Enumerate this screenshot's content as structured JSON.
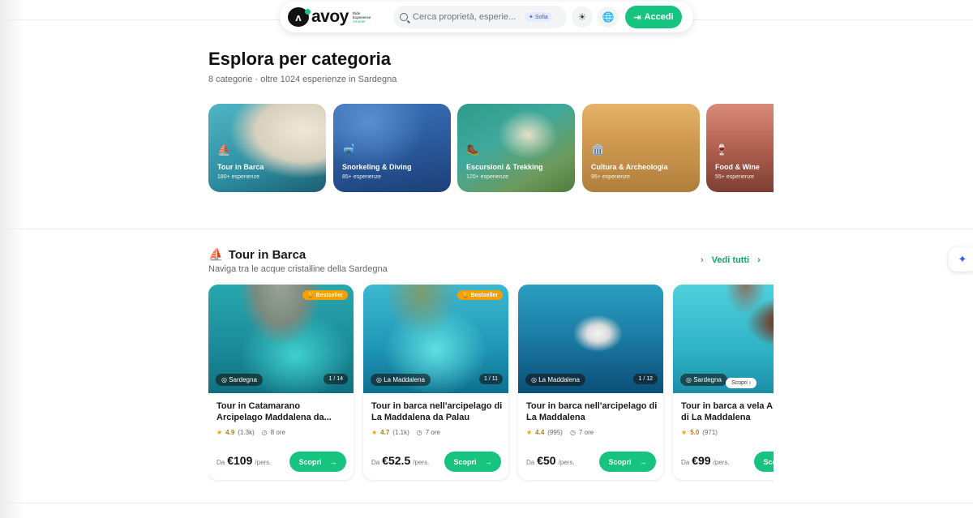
{
  "header": {
    "logo_word": "avoy",
    "logo_tag": [
      "Ride",
      "Experience",
      "Smarter"
    ],
    "search_placeholder": "Cerca proprietà, esperie...",
    "assistant_badge": "Sofia",
    "login_label": "Accedi",
    "icons": [
      "sun-icon",
      "globe-icon"
    ]
  },
  "categories_section": {
    "title": "Esplora per categoria",
    "subtitle": "8 categorie · oltre 1024 esperienze in Sardegna",
    "items": [
      {
        "icon": "⛵",
        "name": "Tour in Barca",
        "count": "180+ esperienze",
        "color_a": "#3fa7b8",
        "color_b": "#d9d4c6"
      },
      {
        "icon": "🤿",
        "name": "Snorkeling & Diving",
        "count": "85+ esperienze",
        "color_a": "#2b5fa8",
        "color_b": "#3a7cc4"
      },
      {
        "icon": "🥾",
        "name": "Escursioni & Trekking",
        "count": "120+ esperienze",
        "color_a": "#4aa89a",
        "color_b": "#6b8f55"
      },
      {
        "icon": "🏛️",
        "name": "Cultura & Archeologia",
        "count": "95+ esperienze",
        "color_a": "#c99a55",
        "color_b": "#b07f3c"
      },
      {
        "icon": "🍷",
        "name": "Food & Wine",
        "count": "55+ esperienze",
        "color_a": "#c96f6f",
        "color_b": "#8f4a3c"
      }
    ]
  },
  "tour_section": {
    "icon": "⛵",
    "title": "Tour in Barca",
    "subtitle": "Naviga tra le acque cristalline della Sardegna",
    "see_all": "Vedi tutti",
    "cards": [
      {
        "badge": "Bestseller",
        "location": "Sardegna",
        "pager": "1 / 14",
        "title": "Tour in Catamarano Arcipelago Maddalena da...",
        "rating": "4.9",
        "reviews": "(1.3k)",
        "duration": "8 ore",
        "price_prefix": "Da",
        "price": "€109",
        "price_unit": "/pers.",
        "cta": "Scopri",
        "color_a": "#1fa7b0",
        "color_b": "#0e6f86"
      },
      {
        "badge": "Bestseller",
        "location": "La Maddalena",
        "pager": "1 / 11",
        "title": "Tour in barca nell'arcipelago di La Maddalena da Palau",
        "rating": "4.7",
        "reviews": "(1.1k)",
        "duration": "7 ore",
        "price_prefix": "Da",
        "price": "€52.5",
        "price_unit": "/pers.",
        "cta": "Scopri",
        "color_a": "#24b3c4",
        "color_b": "#0f6f8f"
      },
      {
        "badge": "",
        "location": "La Maddalena",
        "pager": "1 / 12",
        "title": "Tour in barca nell'arcipelago di La Maddalena",
        "rating": "4.4",
        "reviews": "(995)",
        "duration": "7 ore",
        "price_prefix": "Da",
        "price": "€50",
        "price_unit": "/pers.",
        "cta": "Scopri",
        "color_a": "#1d8fb0",
        "color_b": "#0b4f78"
      },
      {
        "badge": "",
        "location": "Sardegna",
        "pager": "",
        "chip": "Scopri",
        "title": "Tour in barca a vela Arcipelago di La Maddalena",
        "rating": "5.0",
        "reviews": "(971)",
        "duration": "",
        "price_prefix": "Da",
        "price": "€99",
        "price_unit": "/pers.",
        "cta": "Scopri",
        "color_a": "#3cc4d4",
        "color_b": "#1b8fa8"
      }
    ]
  }
}
